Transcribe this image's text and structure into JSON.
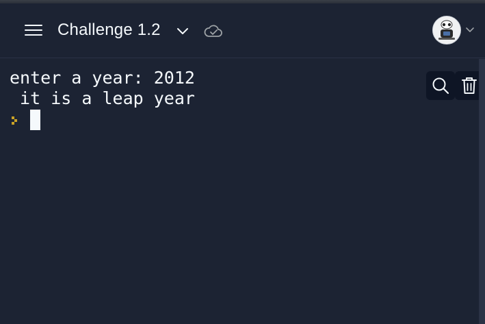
{
  "header": {
    "title": "Challenge 1.2",
    "menu_icon": "hamburger-menu-icon",
    "title_dropdown_icon": "chevron-down-icon",
    "status_icon": "cloud-check-icon",
    "avatar_icon": "user-avatar",
    "avatar_dropdown_icon": "chevron-down-icon"
  },
  "console": {
    "lines": [
      "enter a year: 2012",
      " it is a leap year"
    ],
    "input_value": "",
    "search_icon": "search-icon",
    "clear_icon": "trash-icon"
  },
  "colors": {
    "background": "#1c2333",
    "text": "#f5f9fc",
    "prompt_accent": "#c9a227",
    "button_background": "#0e1525"
  }
}
